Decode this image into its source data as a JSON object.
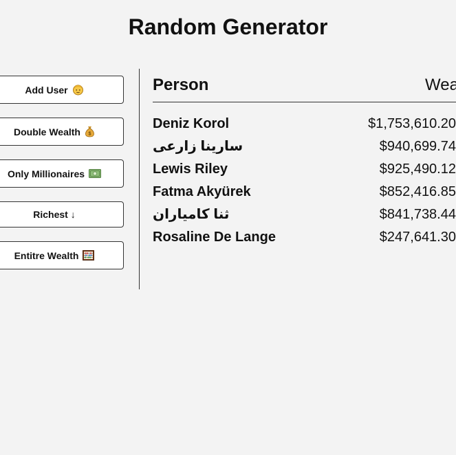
{
  "title": "Random Generator",
  "buttons": {
    "add_user": "Add User",
    "double_wealth": "Double Wealth",
    "only_millionaires": "Only Millionaires",
    "richest": "Richest ↓",
    "entire_wealth": "Entitre Wealth"
  },
  "table": {
    "header_person": "Person",
    "header_wealth": "Wealth",
    "rows": [
      {
        "name": "Deniz Korol",
        "wealth": "$1,753,610.20"
      },
      {
        "name": "سارینا زارعی",
        "wealth": "$940,699.74"
      },
      {
        "name": "Lewis Riley",
        "wealth": "$925,490.12"
      },
      {
        "name": "Fatma Akyürek",
        "wealth": "$852,416.85"
      },
      {
        "name": "ثنا کامیاران",
        "wealth": "$841,738.44"
      },
      {
        "name": "Rosaline De Lange",
        "wealth": "$247,641.30"
      }
    ]
  }
}
